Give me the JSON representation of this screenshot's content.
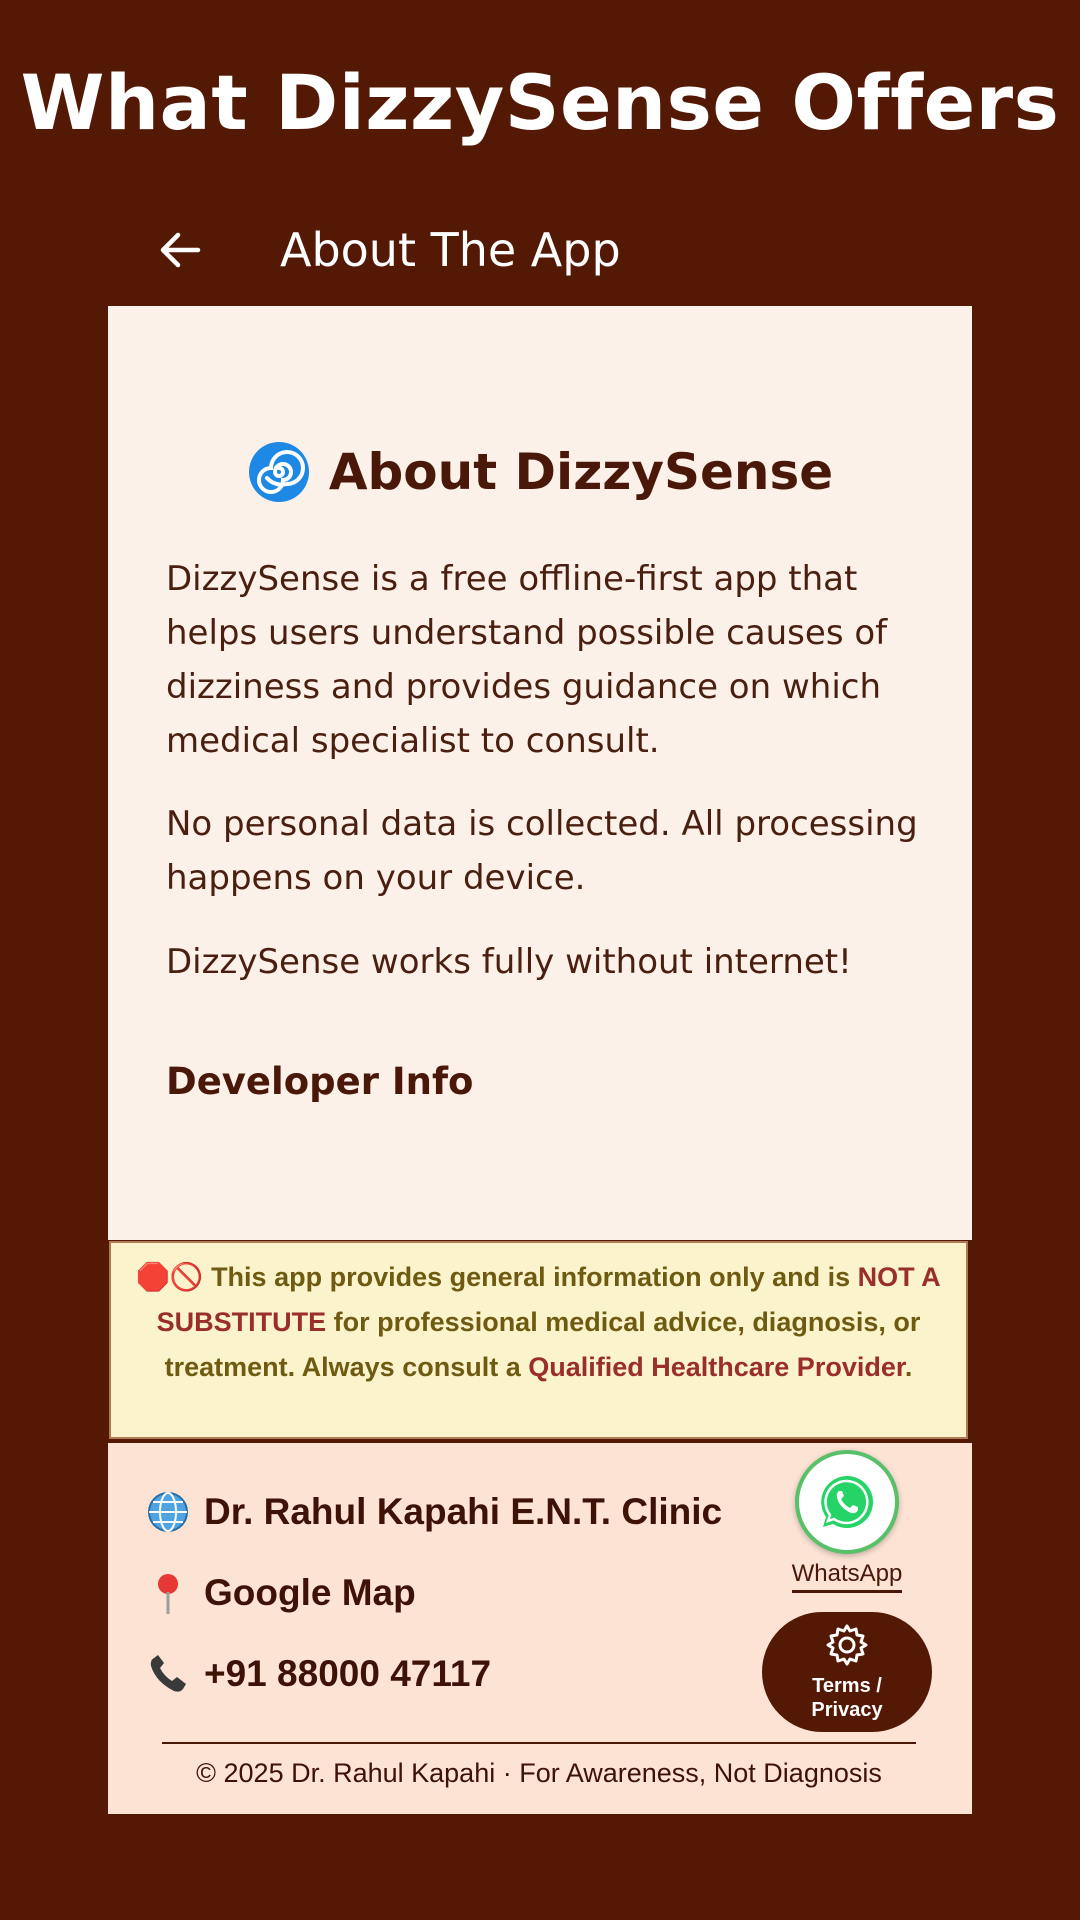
{
  "promo": {
    "title": "What DizzySense Offers"
  },
  "appbar": {
    "title": "About The App",
    "back_icon": "arrow-left-icon"
  },
  "about": {
    "heading_icon": "🌀",
    "heading": "About DizzySense",
    "paragraphs": [
      "DizzySense is a free offline-first app that helps users understand possible causes of dizziness and provides guidance on which medical specialist to consult.",
      "No personal data is collected. All processing happens on your device.",
      "DizzySense works fully without internet!"
    ],
    "developer_info": "Developer Info"
  },
  "disclaimer": {
    "icons": "🛑🚫",
    "part1": " This app provides general information only and is ",
    "emphasis1": "NOT A SUBSTITUTE",
    "part2": " for professional medical advice, diagnosis, or treatment. Always consult a ",
    "emphasis2": "Qualified Healthcare Provider",
    "part3": "."
  },
  "footer": {
    "links": [
      {
        "icon": "🌐",
        "label": "Dr. Rahul Kapahi E.N.T. Clinic"
      },
      {
        "icon": "📍",
        "label": "Google Map"
      },
      {
        "icon": "📞",
        "label": "+91 88000 47117"
      }
    ],
    "whatsapp_label": "WhatsApp",
    "terms_label_line1": "Terms /",
    "terms_label_line2": "Privacy",
    "copyright": "© 2025 Dr. Rahul Kapahi · For Awareness, Not Diagnosis"
  },
  "colors": {
    "background": "#541905",
    "card": "#fcf1e9",
    "disclaimer_bg": "#fbf3cc",
    "footer_bg": "#fce3d4",
    "accent": "#9a2e2a",
    "whatsapp": "#25d366"
  }
}
